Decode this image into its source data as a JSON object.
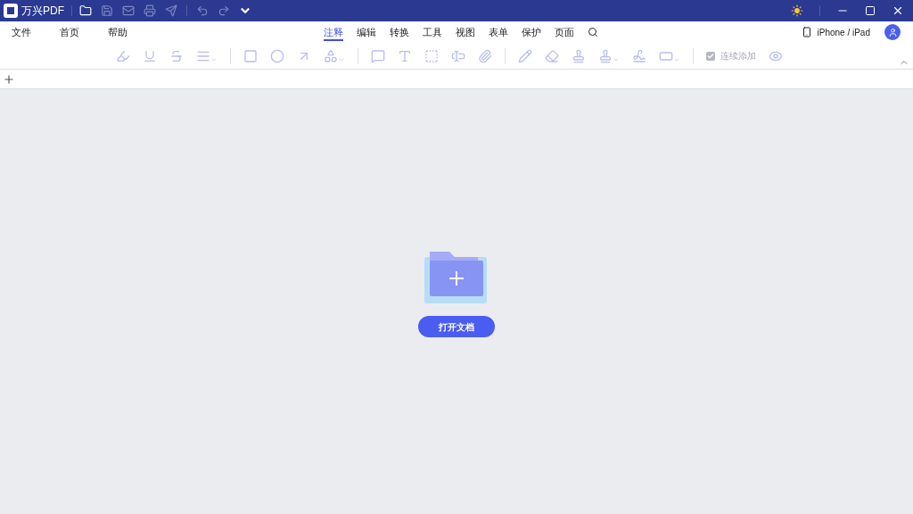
{
  "app": {
    "title": "万兴PDF"
  },
  "menu": [
    "文件",
    "首页",
    "帮助"
  ],
  "ribbon_tabs": [
    {
      "label": "注释",
      "selected": true
    },
    {
      "label": "编辑",
      "selected": false
    },
    {
      "label": "转换",
      "selected": false
    },
    {
      "label": "工具",
      "selected": false
    },
    {
      "label": "视图",
      "selected": false
    },
    {
      "label": "表单",
      "selected": false
    },
    {
      "label": "保护",
      "selected": false
    },
    {
      "label": "页面",
      "selected": false
    }
  ],
  "device_link": "iPhone / iPad",
  "continuous_add": {
    "label": "连续添加",
    "checked": true
  },
  "open_button": "打开文档"
}
